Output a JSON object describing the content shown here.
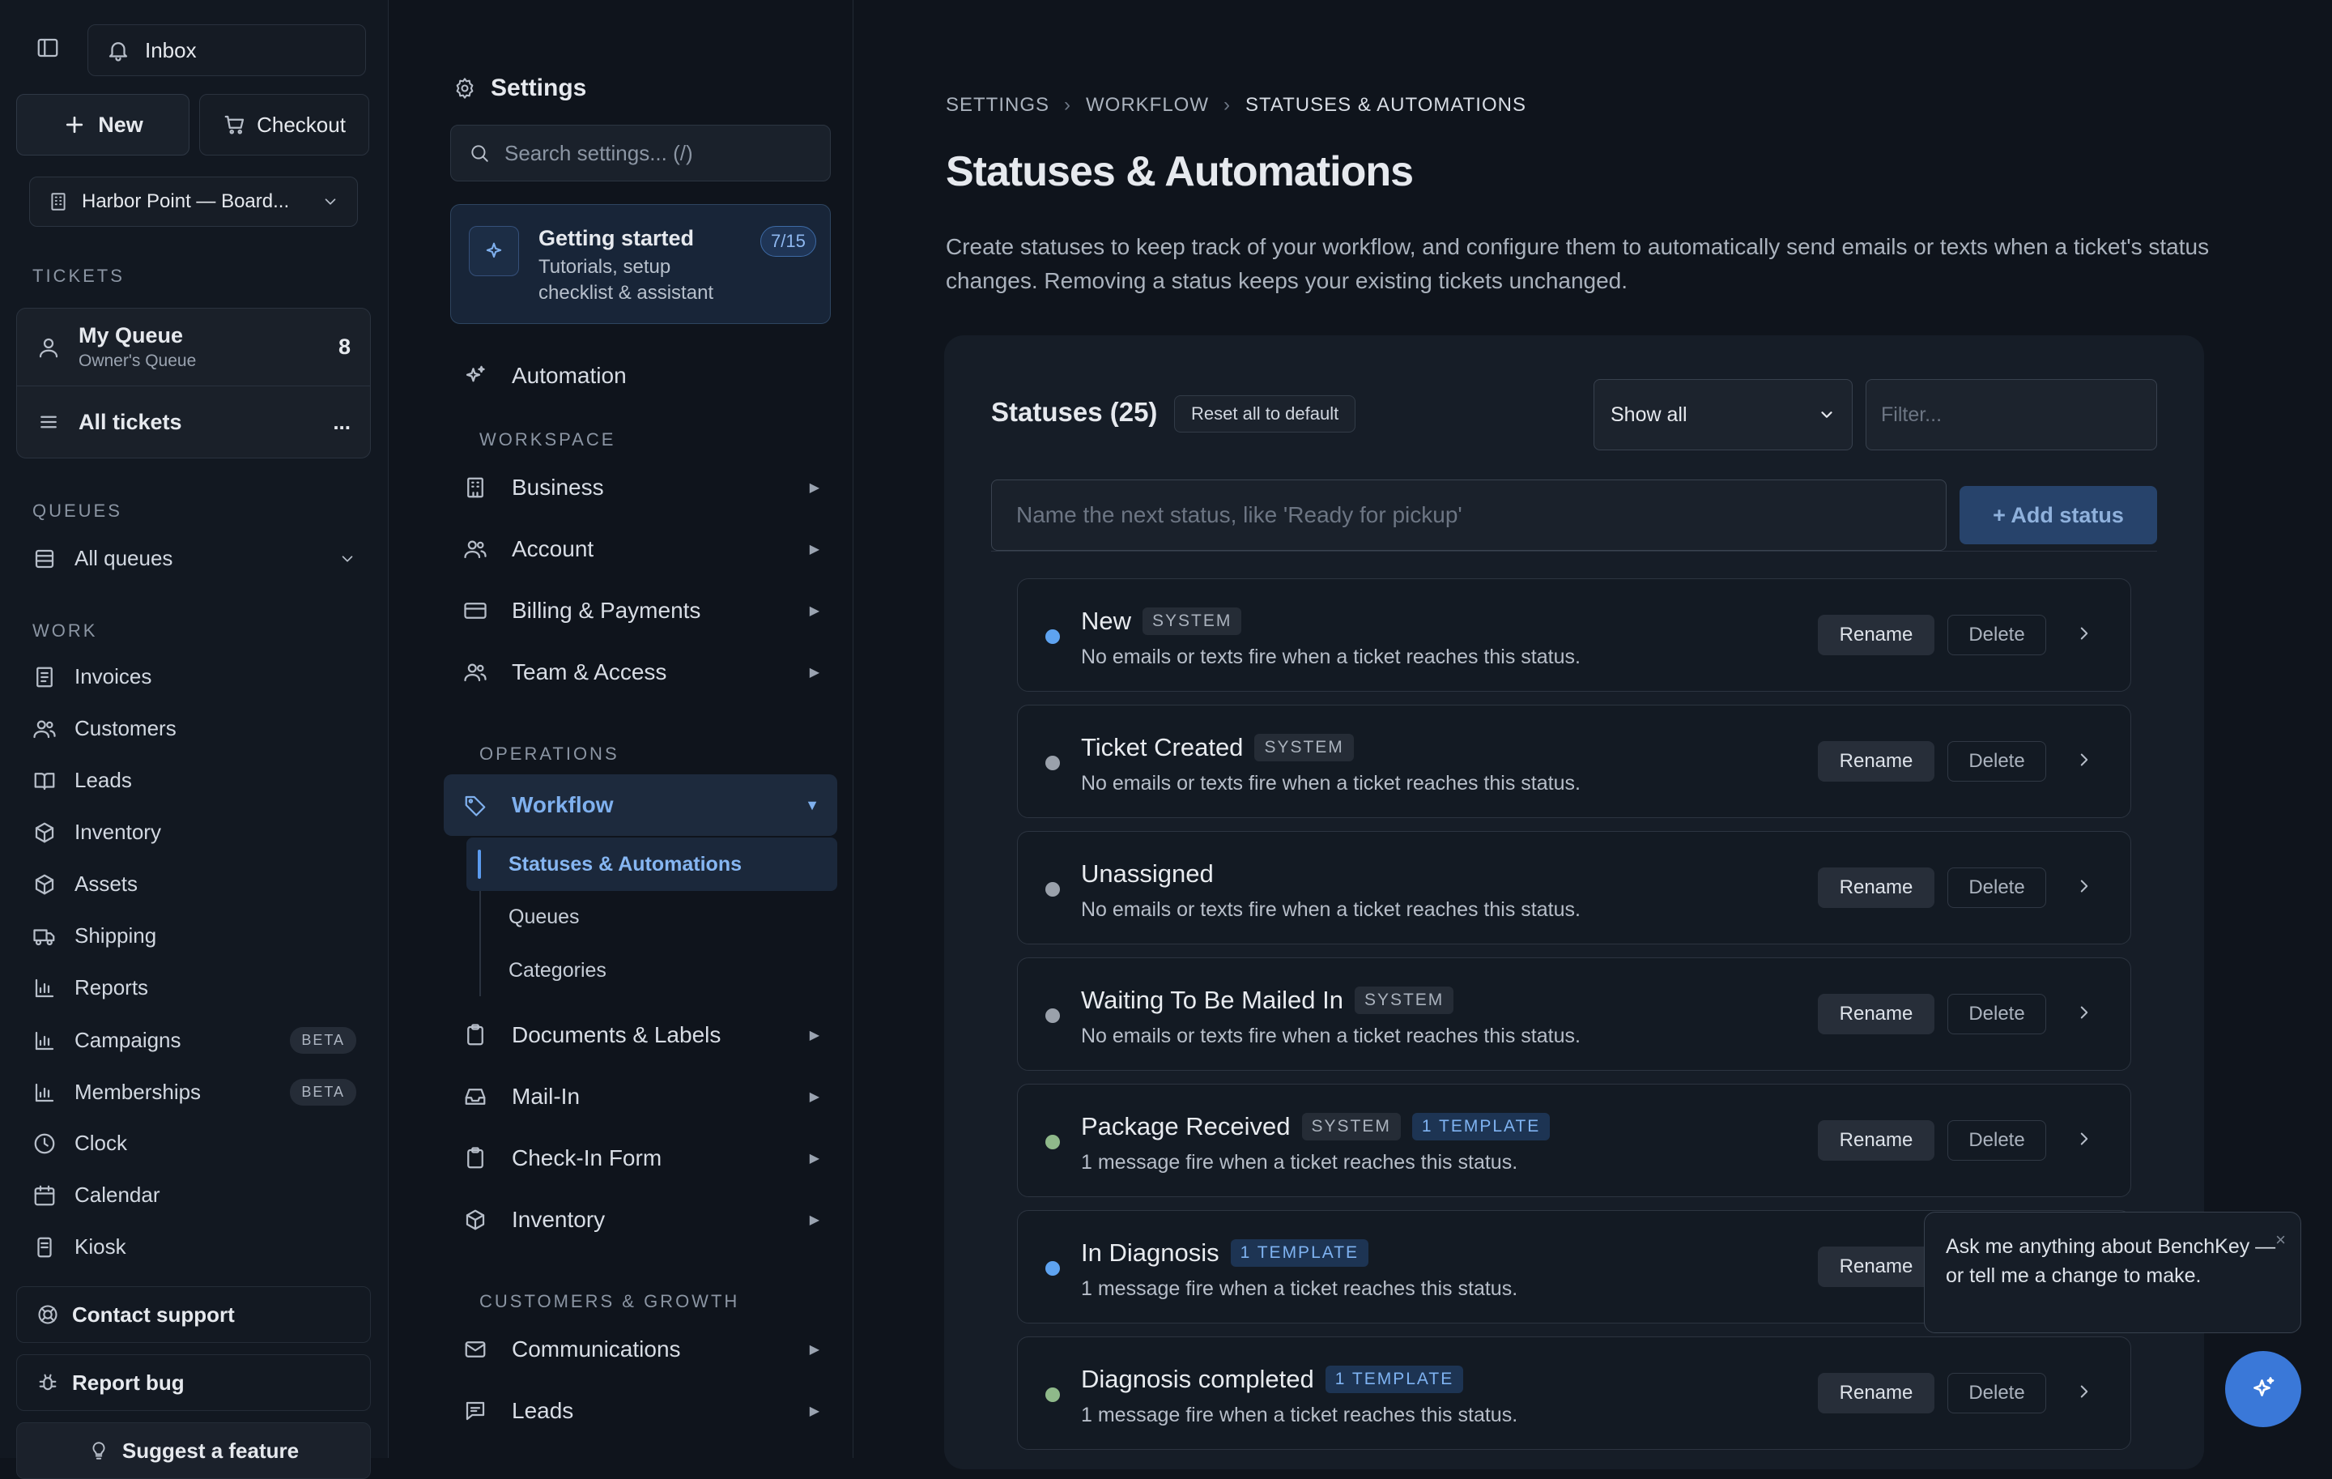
{
  "sidebar": {
    "inbox_label": "Inbox",
    "new_label": "New",
    "checkout_label": "Checkout",
    "store_name": "Harbor Point — Board...",
    "tickets_heading": "TICKETS",
    "my_queue": {
      "title": "My Queue",
      "subtitle": "Owner's Queue",
      "count": "8"
    },
    "all_tickets_label": "All tickets",
    "all_tickets_more": "...",
    "queues_heading": "QUEUES",
    "all_queues_label": "All queues",
    "work_heading": "WORK",
    "work_items": [
      {
        "label": "Invoices",
        "icon": "invoice-icon"
      },
      {
        "label": "Customers",
        "icon": "users-icon"
      },
      {
        "label": "Leads",
        "icon": "book-icon"
      },
      {
        "label": "Inventory",
        "icon": "box-icon"
      },
      {
        "label": "Assets",
        "icon": "box-icon"
      },
      {
        "label": "Shipping",
        "icon": "truck-icon"
      },
      {
        "label": "Reports",
        "icon": "bar-chart-icon"
      },
      {
        "label": "Campaigns",
        "icon": "bar-chart-icon",
        "badge": "BETA"
      },
      {
        "label": "Memberships",
        "icon": "bar-chart-icon",
        "badge": "BETA"
      },
      {
        "label": "Clock",
        "icon": "clock-icon"
      },
      {
        "label": "Calendar",
        "icon": "calendar-icon"
      },
      {
        "label": "Kiosk",
        "icon": "tablet-icon"
      }
    ],
    "contact_support_label": "Contact support",
    "report_bug_label": "Report bug",
    "suggest_feature_label": "Suggest a feature"
  },
  "settings_nav": {
    "title": "Settings",
    "search_placeholder": "Search settings... (/)",
    "getting_started": {
      "title": "Getting started",
      "subtitle": "Tutorials, setup checklist & assistant",
      "progress": "7/15"
    },
    "automation_label": "Automation",
    "workspace_heading": "WORKSPACE",
    "workspace_items": [
      "Business",
      "Account",
      "Billing & Payments",
      "Team & Access"
    ],
    "operations_heading": "OPERATIONS",
    "workflow_label": "Workflow",
    "workflow_sub": [
      "Statuses & Automations",
      "Queues",
      "Categories"
    ],
    "operations_items": [
      "Documents & Labels",
      "Mail-In",
      "Check-In Form",
      "Inventory"
    ],
    "growth_heading": "CUSTOMERS & GROWTH",
    "growth_items": [
      "Communications",
      "Leads"
    ]
  },
  "main": {
    "breadcrumb": [
      "SETTINGS",
      "WORKFLOW",
      "STATUSES & AUTOMATIONS"
    ],
    "title": "Statuses & Automations",
    "description": "Create statuses to keep track of your workflow, and configure them to automatically send emails or texts when a ticket's status changes. Removing a status keeps your existing tickets unchanged.",
    "statuses_title": "Statuses (25)",
    "reset_label": "Reset all to default",
    "show_select_value": "Show all",
    "filter_placeholder": "Filter...",
    "new_status_placeholder": "Name the next status, like 'Ready for pickup'",
    "add_status_label": "+ Add status",
    "rename_label": "Rename",
    "delete_label": "Delete",
    "statuses": [
      {
        "name": "New",
        "system": "SYSTEM",
        "template": "",
        "desc": "No emails or texts fire when a ticket reaches this status.",
        "color": "#5ea3f0"
      },
      {
        "name": "Ticket Created",
        "system": "SYSTEM",
        "template": "",
        "desc": "No emails or texts fire when a ticket reaches this status.",
        "color": "#9aa1ab"
      },
      {
        "name": "Unassigned",
        "system": "",
        "template": "",
        "desc": "No emails or texts fire when a ticket reaches this status.",
        "color": "#9aa1ab"
      },
      {
        "name": "Waiting To Be Mailed In",
        "system": "SYSTEM",
        "template": "",
        "desc": "No emails or texts fire when a ticket reaches this status.",
        "color": "#9aa1ab"
      },
      {
        "name": "Package Received",
        "system": "SYSTEM",
        "template": "1 TEMPLATE",
        "desc": "1 message fire when a ticket reaches this status.",
        "color": "#8fb98a"
      },
      {
        "name": "In Diagnosis",
        "system": "",
        "template": "1 TEMPLATE",
        "desc": "1 message fire when a ticket reaches this status.",
        "color": "#5ea3f0"
      },
      {
        "name": "Diagnosis completed",
        "system": "",
        "template": "1 TEMPLATE",
        "desc": "1 message fire when a ticket reaches this status.",
        "color": "#8fb98a"
      }
    ]
  },
  "assistant": {
    "message": "Ask me anything about BenchKey — or tell me a change to make.",
    "close": "×"
  }
}
